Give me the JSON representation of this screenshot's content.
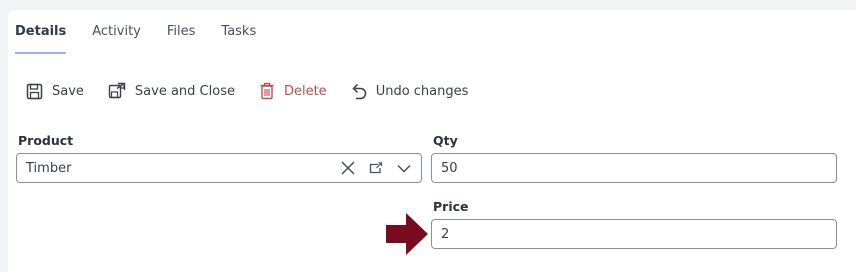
{
  "tabs": [
    {
      "label": "Details",
      "active": true
    },
    {
      "label": "Activity",
      "active": false
    },
    {
      "label": "Files",
      "active": false
    },
    {
      "label": "Tasks",
      "active": false
    }
  ],
  "toolbar": {
    "save": "Save",
    "save_close": "Save and Close",
    "delete": "Delete",
    "undo": "Undo changes"
  },
  "form": {
    "product_label": "Product",
    "product_value": "Timber",
    "qty_label": "Qty",
    "qty_value": "50",
    "price_label": "Price",
    "price_value": "2"
  },
  "icons": {
    "save": "floppy-disk-icon",
    "save_close": "save-and-close-icon",
    "delete": "trash-icon",
    "undo": "undo-icon",
    "clear": "close-icon",
    "open": "open-external-icon",
    "dropdown": "chevron-down-icon",
    "annotation": "pointer-arrow-icon"
  },
  "colors": {
    "delete": "#c44a4a",
    "tab_underline": "#9db4d4",
    "annotation_arrow": "#7a0a1e"
  }
}
